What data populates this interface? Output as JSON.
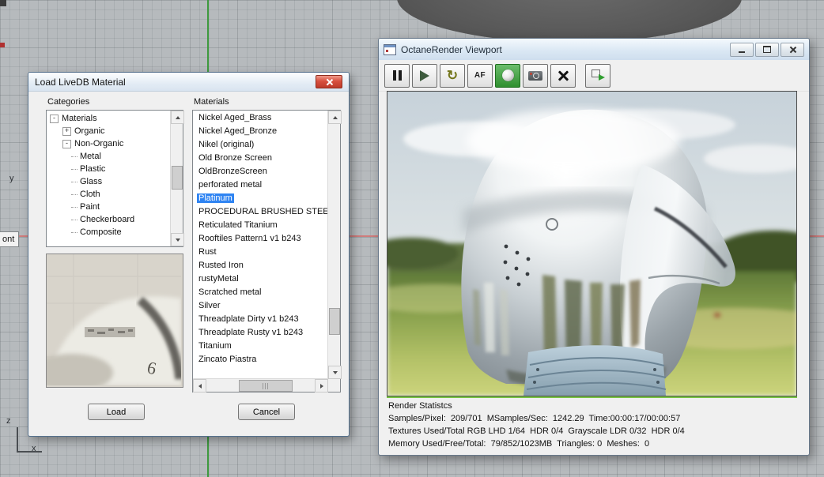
{
  "viewport": {
    "tab_label": "ont",
    "axis_y": "y",
    "axis_z": "z",
    "axis_x": "x"
  },
  "material_dialog": {
    "title": "Load LiveDB Material",
    "categories_label": "Categories",
    "materials_label": "Materials",
    "tree_items": [
      {
        "label": "Materials",
        "level": 0,
        "expander": "minus"
      },
      {
        "label": "Organic",
        "level": 1,
        "expander": "plus"
      },
      {
        "label": "Non-Organic",
        "level": 1,
        "expander": "minus"
      },
      {
        "label": "Metal",
        "level": 2
      },
      {
        "label": "Plastic",
        "level": 2
      },
      {
        "label": "Glass",
        "level": 2
      },
      {
        "label": "Cloth",
        "level": 2
      },
      {
        "label": "Paint",
        "level": 2
      },
      {
        "label": "Checkerboard",
        "level": 2
      },
      {
        "label": "Composite",
        "level": 2
      }
    ],
    "materials": [
      "Nickel Aged_Brass",
      "Nickel Aged_Bronze",
      "Nikel (original)",
      "Old Bronze Screen",
      "OldBronzeScreen",
      "perforated metal",
      "Platinum",
      "PROCEDURAL BRUSHED STEEL",
      "Reticulated Titanium",
      "Rooftiles Pattern1 v1 b243",
      "Rust",
      "Rusted Iron",
      "rustyMetal",
      "Scratched metal",
      "Silver",
      "Threadplate Dirty v1 b243",
      "Threadplate Rusty v1 b243",
      "Titanium",
      "Zincato Piastra"
    ],
    "selected_material": "Platinum",
    "buttons": {
      "load": "Load",
      "cancel": "Cancel"
    }
  },
  "octane_window": {
    "title": "OctaneRender Viewport",
    "toolbar": {
      "af_label": "AF"
    },
    "stats": {
      "title": "Render Statistcs",
      "samples_line": "Samples/Pixel:  209/701  MSamples/Sec:  1242.29  Time:00:00:17/00:00:57",
      "textures_line": "Textures Used/Total RGB LHD 1/64  HDR 0/4  Grayscale LDR 0/32  HDR 0/4",
      "memory_line": "Memory Used/Free/Total:  79/852/1023MB  Triangles: 0  Meshes:  0"
    }
  },
  "icons": {
    "pause-icon": "two vertical bars",
    "play-icon": "right-pointing triangle",
    "restart-icon": "circular arrow ↻",
    "material-picker-icon": "white sphere",
    "camera-icon": "camera with lens",
    "stop-icon": "bold X",
    "export-icon": "window with green arrow",
    "close-icon": "white X on red",
    "minimize-icon": "bar",
    "maximize-icon": "box"
  },
  "colors": {
    "selection": "#2f84f2",
    "toolbar_active": "#3f9f3f",
    "progress_green": "#79c445"
  }
}
